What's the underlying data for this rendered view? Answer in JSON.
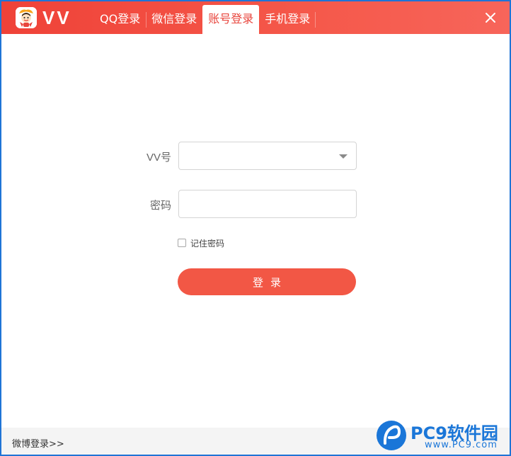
{
  "app": {
    "brand": "VV"
  },
  "tabs": [
    {
      "label": "QQ登录",
      "active": false
    },
    {
      "label": "微信登录",
      "active": false
    },
    {
      "label": "账号登录",
      "active": true
    },
    {
      "label": "手机登录",
      "active": false
    }
  ],
  "form": {
    "vv_label": "VV号",
    "vv_value": "",
    "password_label": "密码",
    "password_value": "",
    "remember_label": "记住密码",
    "remember_checked": false,
    "login_button": "登录"
  },
  "footer": {
    "weibo_link": "微博登录>>"
  },
  "watermark": {
    "text": "PC9软件园",
    "url": "www.PC9.com"
  },
  "colors": {
    "accent": "#f25745",
    "titlebar": "#ef4238",
    "frame": "#1f74d6"
  }
}
